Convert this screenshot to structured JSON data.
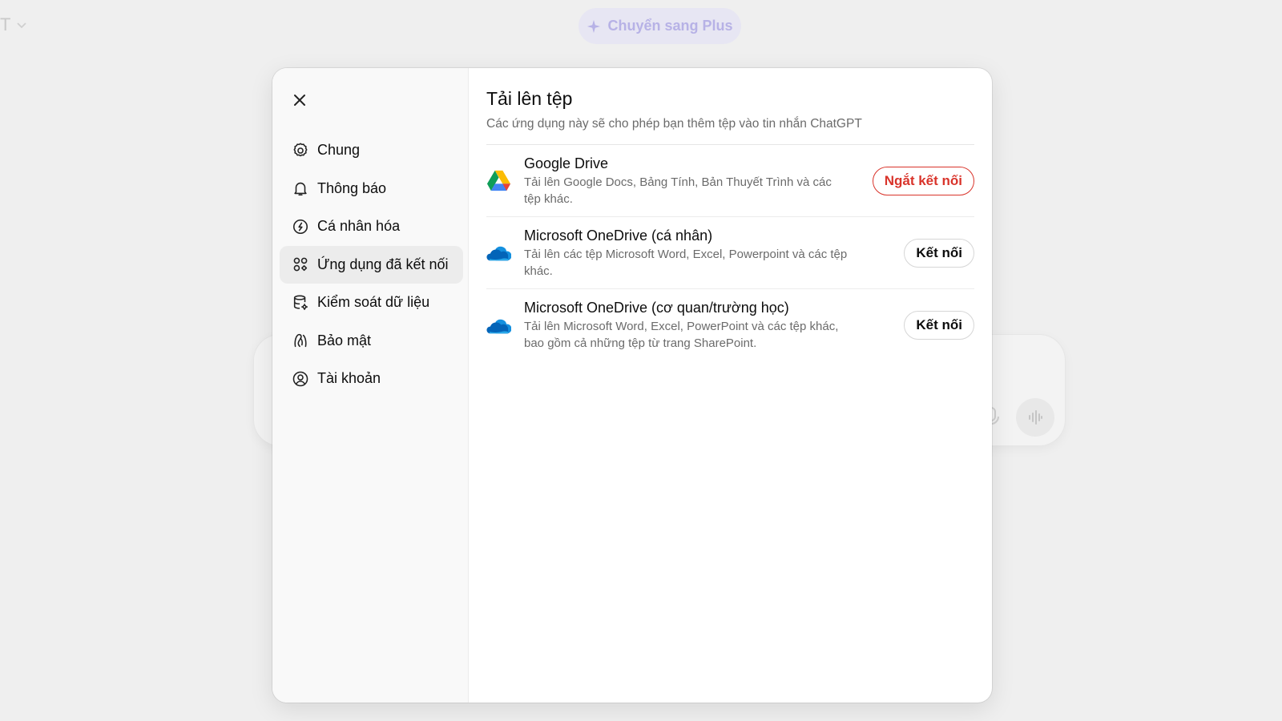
{
  "background": {
    "model_fragment": "T",
    "upgrade_label": "Chuyển sang Plus"
  },
  "sidebar": {
    "items": [
      {
        "label": "Chung",
        "icon": "gear-icon"
      },
      {
        "label": "Thông báo",
        "icon": "bell-icon"
      },
      {
        "label": "Cá nhân hóa",
        "icon": "personalization-icon"
      },
      {
        "label": "Ứng dụng đã kết nối",
        "icon": "apps-icon",
        "active": true
      },
      {
        "label": "Kiểm soát dữ liệu",
        "icon": "database-icon"
      },
      {
        "label": "Bảo mật",
        "icon": "security-icon"
      },
      {
        "label": "Tài khoản",
        "icon": "account-icon"
      }
    ]
  },
  "main": {
    "title": "Tải lên tệp",
    "subtitle": "Các ứng dụng này sẽ cho phép bạn thêm tệp vào tin nhắn ChatGPT",
    "apps": [
      {
        "name": "Google Drive",
        "description": "Tải lên Google Docs, Bảng Tính, Bản Thuyết Trình và các tệp khác.",
        "action": "Ngắt kết nối",
        "icon": "google-drive-icon"
      },
      {
        "name": "Microsoft OneDrive (cá nhân)",
        "description": "Tải lên các tệp Microsoft Word, Excel, Powerpoint và các tệp khác.",
        "action": "Kết nối",
        "icon": "onedrive-icon"
      },
      {
        "name": "Microsoft OneDrive (cơ quan/trường học)",
        "description": "Tải lên Microsoft Word, Excel, PowerPoint và các tệp khác, bao gồm cả những tệp từ trang SharePoint.",
        "action": "Kết nối",
        "icon": "onedrive-icon"
      }
    ]
  },
  "colors": {
    "disconnect": "#d9342b",
    "active_nav_bg": "#ececec",
    "sidebar_bg": "#f9f9f9"
  }
}
